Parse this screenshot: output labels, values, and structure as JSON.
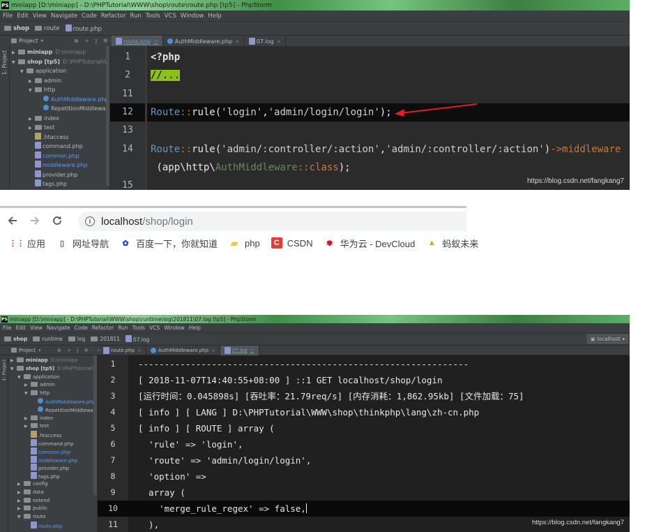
{
  "top_window": {
    "title": "miniapp [D:\\miniapp] - D:\\PHPTutorial\\WWW\\shop\\route\\route.php [tp5] - PhpStorm",
    "menu": [
      "File",
      "Edit",
      "View",
      "Navigate",
      "Code",
      "Refactor",
      "Run",
      "Tools",
      "VCS",
      "Window",
      "Help"
    ],
    "breadcrumb": [
      "shop",
      "route",
      "route.php"
    ],
    "project_label": "Project",
    "side_strip_label": "1: Project",
    "tabs": [
      {
        "label": "route.php",
        "active": true
      },
      {
        "label": "AuthMiddleware.php",
        "active": false
      },
      {
        "label": "07.log",
        "active": false
      }
    ],
    "tree": [
      {
        "label": "miniapp",
        "dim": "D:\\miniapp",
        "indent": 0,
        "arrow": "right",
        "type": "folder"
      },
      {
        "label": "shop [tp5]",
        "dim": "D:\\PHPTutorial\\WW",
        "indent": 0,
        "arrow": "down",
        "type": "folder"
      },
      {
        "label": "application",
        "indent": 1,
        "arrow": "down",
        "type": "folder"
      },
      {
        "label": "admin",
        "indent": 2,
        "arrow": "right",
        "type": "folder"
      },
      {
        "label": "http",
        "indent": 2,
        "arrow": "down",
        "type": "folder"
      },
      {
        "label": "AuthMiddleware.php",
        "indent": 3,
        "arrow": "",
        "type": "class",
        "blue": true
      },
      {
        "label": "RepetitionMiddleware",
        "indent": 3,
        "arrow": "",
        "type": "class"
      },
      {
        "label": "index",
        "indent": 2,
        "arrow": "right",
        "type": "folder"
      },
      {
        "label": "test",
        "indent": 2,
        "arrow": "right",
        "type": "folder"
      },
      {
        "label": ".htaccess",
        "indent": 2,
        "arrow": "",
        "type": "file"
      },
      {
        "label": "command.php",
        "indent": 2,
        "arrow": "",
        "type": "php"
      },
      {
        "label": "common.php",
        "indent": 2,
        "arrow": "",
        "type": "php",
        "blue": true
      },
      {
        "label": "middleware.php",
        "indent": 2,
        "arrow": "",
        "type": "php",
        "blue": true
      },
      {
        "label": "provider.php",
        "indent": 2,
        "arrow": "",
        "type": "php"
      },
      {
        "label": "tags.php",
        "indent": 2,
        "arrow": "",
        "type": "php"
      }
    ],
    "code_lines": [
      {
        "no": "1",
        "parts": [
          {
            "t": "<?php",
            "c": "kw"
          }
        ]
      },
      {
        "no": "2",
        "parts": [
          {
            "t": "//...",
            "c": "cm"
          }
        ]
      },
      {
        "no": "11",
        "parts": []
      },
      {
        "no": "12",
        "parts": [
          {
            "t": "Route",
            "c": "cls"
          },
          {
            "t": "::",
            "c": "op"
          },
          {
            "t": "rule(",
            "c": "fn"
          },
          {
            "t": "'login'",
            "c": "str"
          },
          {
            "t": ",",
            "c": "fn"
          },
          {
            "t": "'admin/login/login'",
            "c": "str"
          },
          {
            "t": ");",
            "c": "fn"
          }
        ],
        "highlight": true
      },
      {
        "no": "13",
        "parts": []
      },
      {
        "no": "14",
        "parts": [
          {
            "t": "Route",
            "c": "cls"
          },
          {
            "t": "::",
            "c": "op"
          },
          {
            "t": "rule(",
            "c": "fn"
          },
          {
            "t": "'admin/:controller/:action'",
            "c": "str"
          },
          {
            "t": ",",
            "c": "fn"
          },
          {
            "t": "'admin/:controller/:action'",
            "c": "str"
          },
          {
            "t": ")",
            "c": "fn"
          },
          {
            "t": "->middleware",
            "c": "op"
          }
        ]
      },
      {
        "no": "",
        "parts": [
          {
            "t": " (app\\http\\",
            "c": "fn"
          },
          {
            "t": "AuthMiddleware",
            "c": "ns"
          },
          {
            "t": "::",
            "c": "op"
          },
          {
            "t": "class",
            "c": "op"
          },
          {
            "t": ");",
            "c": "fn"
          }
        ]
      },
      {
        "no": "15",
        "parts": []
      }
    ],
    "watermark": "https://blog.csdn.net/fangkang7"
  },
  "browser": {
    "url_host": "localhost",
    "url_path": "/shop/login",
    "bookmarks": [
      {
        "label": "应用",
        "icon": "apps-icon",
        "color": "#e8453c"
      },
      {
        "label": "网址导航",
        "icon": "page-icon",
        "color": "#5f6368"
      },
      {
        "label": "百度一下，你就知道",
        "icon": "baidu-icon",
        "color": "#2932e1"
      },
      {
        "label": "php",
        "icon": "folder-icon",
        "color": "#f6c744"
      },
      {
        "label": "CSDN",
        "icon": "csdn-icon",
        "color": "#e33e33"
      },
      {
        "label": "华为云 - DevCloud",
        "icon": "huawei-icon",
        "color": "#e4001b"
      },
      {
        "label": "蚂蚁未来",
        "icon": "pma-icon",
        "color": "#d9a400"
      }
    ]
  },
  "bottom_window": {
    "title": "miniapp [D:\\miniapp] - D:\\PHPTutorial\\WWW\\shop\\runtime\\log\\201811\\07.log [tp5] - PhpStorm",
    "menu": [
      "File",
      "Edit",
      "View",
      "Navigate",
      "Code",
      "Refactor",
      "Run",
      "Tools",
      "VCS",
      "Window",
      "Help"
    ],
    "breadcrumb": [
      "shop",
      "runtime",
      "log",
      "201811",
      "07.log"
    ],
    "run_config": "localhost",
    "project_label": "Project",
    "side_strip_label": "1: Project",
    "tabs": [
      {
        "label": "route.php",
        "active": false
      },
      {
        "label": "AuthMiddleware.php",
        "active": false
      },
      {
        "label": "07.log",
        "active": true
      }
    ],
    "tree": [
      {
        "label": "miniapp",
        "dim": "D:\\miniapp",
        "indent": 0,
        "arrow": "right",
        "type": "folder"
      },
      {
        "label": "shop [tp5]",
        "dim": "D:\\PHPTutorial\\WW",
        "indent": 0,
        "arrow": "down",
        "type": "folder"
      },
      {
        "label": "application",
        "indent": 1,
        "arrow": "down",
        "type": "folder"
      },
      {
        "label": "admin",
        "indent": 2,
        "arrow": "right",
        "type": "folder"
      },
      {
        "label": "http",
        "indent": 2,
        "arrow": "down",
        "type": "folder"
      },
      {
        "label": "AuthMiddleware.php",
        "indent": 3,
        "arrow": "",
        "type": "class",
        "blue": true
      },
      {
        "label": "RepetitionMiddleware",
        "indent": 3,
        "arrow": "",
        "type": "class"
      },
      {
        "label": "index",
        "indent": 2,
        "arrow": "right",
        "type": "folder"
      },
      {
        "label": "test",
        "indent": 2,
        "arrow": "right",
        "type": "folder"
      },
      {
        "label": ".htaccess",
        "indent": 2,
        "arrow": "",
        "type": "file"
      },
      {
        "label": "command.php",
        "indent": 2,
        "arrow": "",
        "type": "php"
      },
      {
        "label": "common.php",
        "indent": 2,
        "arrow": "",
        "type": "php",
        "blue": true
      },
      {
        "label": "middleware.php",
        "indent": 2,
        "arrow": "",
        "type": "php",
        "blue": true
      },
      {
        "label": "provider.php",
        "indent": 2,
        "arrow": "",
        "type": "php"
      },
      {
        "label": "tags.php",
        "indent": 2,
        "arrow": "",
        "type": "php"
      },
      {
        "label": "config",
        "indent": 1,
        "arrow": "right",
        "type": "folder"
      },
      {
        "label": "data",
        "indent": 1,
        "arrow": "right",
        "type": "folder"
      },
      {
        "label": "extend",
        "indent": 1,
        "arrow": "right",
        "type": "folder"
      },
      {
        "label": "public",
        "indent": 1,
        "arrow": "right",
        "type": "folder"
      },
      {
        "label": "route",
        "indent": 1,
        "arrow": "down",
        "type": "folder"
      },
      {
        "label": "route.php",
        "indent": 2,
        "arrow": "",
        "type": "php",
        "blue": true
      }
    ],
    "log_lines": [
      {
        "no": "1",
        "text": "---------------------------------------------------------------"
      },
      {
        "no": "2",
        "text": "[ 2018-11-07T14:40:55+08:00 ] ::1 GET localhost/shop/login"
      },
      {
        "no": "3",
        "text": "[运行时间：0.045898s] [吞吐率：21.79req/s] [内存消耗：1,862.95kb] [文件加载：75]"
      },
      {
        "no": "4",
        "text": "[ info ] [ LANG ] D:\\PHPTutorial\\WWW\\shop\\thinkphp\\lang\\zh-cn.php"
      },
      {
        "no": "5",
        "text": "[ info ] [ ROUTE ] array ("
      },
      {
        "no": "6",
        "text": "  'rule' => 'login',"
      },
      {
        "no": "7",
        "text": "  'route' => 'admin/login/login',"
      },
      {
        "no": "8",
        "text": "  'option' =>"
      },
      {
        "no": "9",
        "text": "  array ("
      },
      {
        "no": "10",
        "text": "    'merge_rule_regex' => false,",
        "highlight": true
      },
      {
        "no": "11",
        "text": "  ),"
      }
    ],
    "watermark": "https://blog.csdn.net/fangkang7"
  }
}
